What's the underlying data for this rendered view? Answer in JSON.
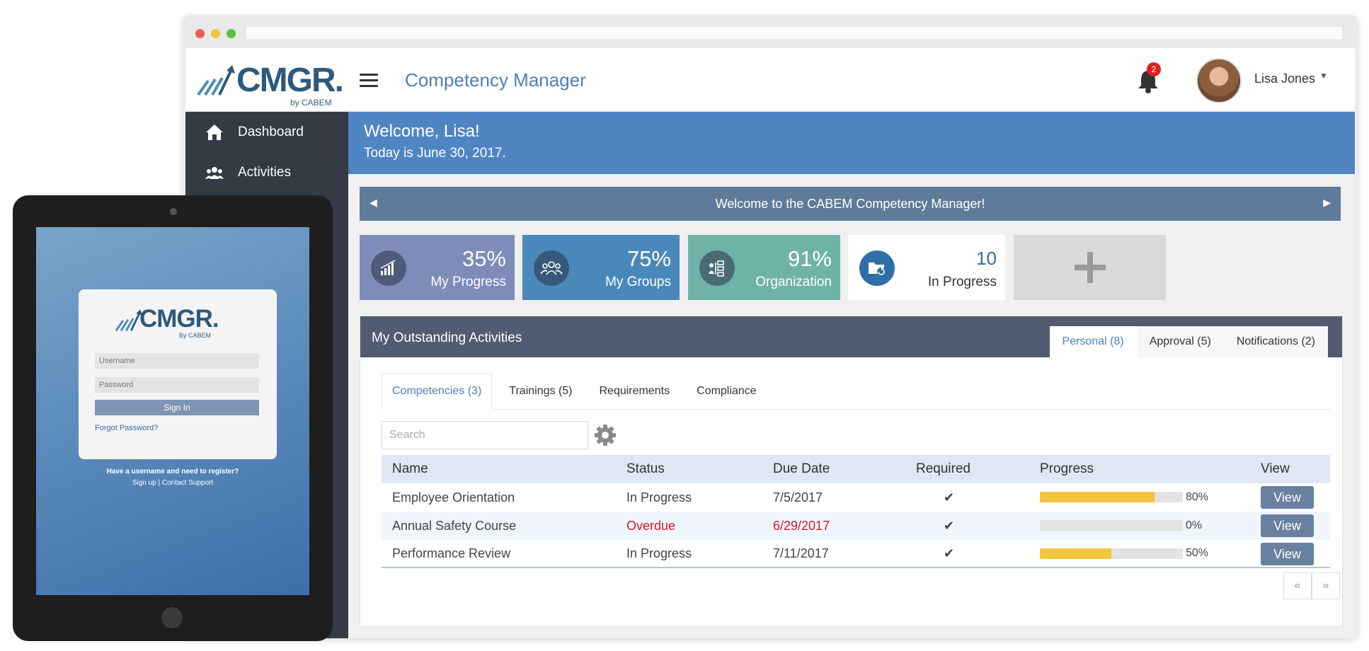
{
  "app": {
    "logo_text": "CMGR.",
    "logo_sub": "by CABEM",
    "title": "Competency Manager",
    "notification_count": "2",
    "user_name": "Lisa Jones"
  },
  "sidebar": {
    "items": [
      {
        "label": "Dashboard",
        "icon": "home-icon"
      },
      {
        "label": "Activities",
        "icon": "users-icon"
      }
    ]
  },
  "welcome": {
    "greeting": "Welcome, Lisa!",
    "date_line": "Today is June 30, 2017."
  },
  "carousel": {
    "message": "Welcome to the CABEM Competency Manager!"
  },
  "tiles": [
    {
      "value": "35%",
      "label": "My Progress",
      "icon": "chart-icon"
    },
    {
      "value": "75%",
      "label": "My Groups",
      "icon": "group-icon"
    },
    {
      "value": "91%",
      "label": "Organization",
      "icon": "org-icon"
    },
    {
      "value": "10",
      "label": "In Progress",
      "icon": "folder-refresh-icon"
    },
    {
      "value": "+",
      "label": "",
      "icon": "plus-icon"
    }
  ],
  "activities": {
    "title": "My Outstanding Activities",
    "tabs": [
      "Personal (8)",
      "Approval (5)",
      "Notifications (2)"
    ],
    "subtabs": [
      "Competencies (3)",
      "Trainings (5)",
      "Requirements",
      "Compliance"
    ],
    "search_placeholder": "Search",
    "columns": [
      "Name",
      "Status",
      "Due Date",
      "Required",
      "Progress",
      "View"
    ],
    "rows": [
      {
        "name": "Employee Orientation",
        "status": "In Progress",
        "due": "7/5/2017",
        "required": "✔",
        "progress": 0.8,
        "progress_text": "80%",
        "view": "View",
        "overdue": false
      },
      {
        "name": "Annual Safety Course",
        "status": "Overdue",
        "due": "6/29/2017",
        "required": "✔",
        "progress": 0.0,
        "progress_text": "0%",
        "view": "View",
        "overdue": true
      },
      {
        "name": "Performance Review",
        "status": "In Progress",
        "due": "7/11/2017",
        "required": "✔",
        "progress": 0.5,
        "progress_text": "50%",
        "view": "View",
        "overdue": false
      }
    ],
    "pager": [
      "«",
      "»"
    ]
  },
  "tablet_login": {
    "logo_text": "CMGR.",
    "logo_sub": "By CABEM",
    "username_placeholder": "Username",
    "password_placeholder": "Password",
    "sign_in": "Sign In",
    "forgot": "Forgot Password?",
    "register_prompt": "Have a username and need to register?",
    "register_links": "Sign up | Contact Support"
  },
  "colors": {
    "brand_blue": "#4f85c2",
    "sidebar": "#353b45",
    "progress_fill": "#f2c53d",
    "overdue_red": "#d0192a"
  }
}
